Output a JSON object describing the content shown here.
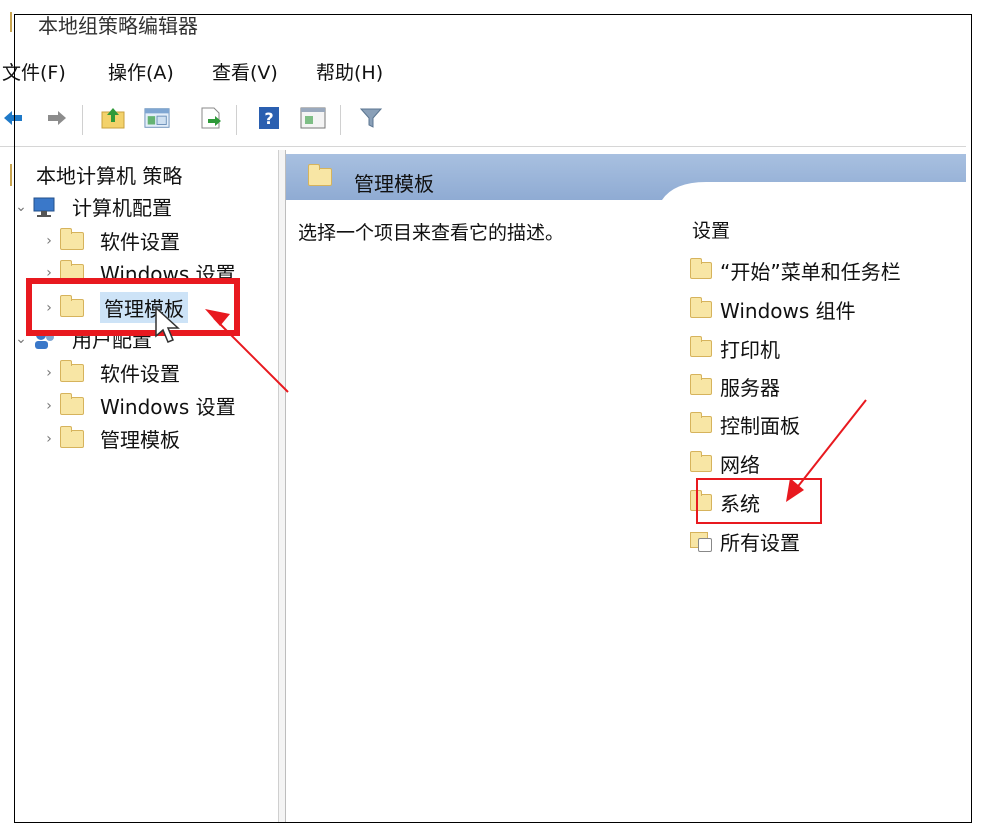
{
  "window": {
    "title": "本地组策略编辑器"
  },
  "menu": [
    "文件(F)",
    "操作(A)",
    "查看(V)",
    "帮助(H)"
  ],
  "tree": {
    "root": "本地计算机 策略",
    "computer_config": "计算机配置",
    "computer_children": [
      "软件设置",
      "Windows 设置",
      "管理模板"
    ],
    "user_config": "用户配置",
    "user_children": [
      "软件设置",
      "Windows 设置",
      "管理模板"
    ]
  },
  "right_pane": {
    "header": "管理模板",
    "description": "选择一个项目来查看它的描述。",
    "column_header": "设置",
    "items": [
      "“开始”菜单和任务栏",
      "Windows 组件",
      "打印机",
      "服务器",
      "控制面板",
      "网络",
      "系统",
      "所有设置"
    ]
  },
  "colors": {
    "annotation_red": "#e8191f",
    "header_band": "#9ab3d6",
    "folder_fill": "#f8e6a5",
    "selection": "#cde3f7"
  },
  "icons": [
    "back-arrow-icon",
    "forward-arrow-icon",
    "up-folder-icon",
    "show-hide-tree-icon",
    "export-list-icon",
    "help-icon",
    "properties-icon",
    "filter-icon"
  ]
}
